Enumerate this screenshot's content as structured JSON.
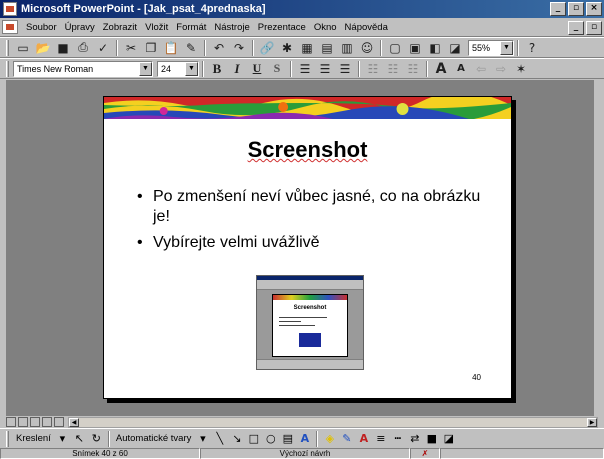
{
  "window": {
    "title": "Microsoft PowerPoint - [Jak_psat_4prednaska]",
    "minimize": "_",
    "restore": "▫",
    "close": "×",
    "doc_minimize": "_",
    "doc_restore": "▫"
  },
  "menu": {
    "items": [
      "Soubor",
      "Úpravy",
      "Zobrazit",
      "Vložit",
      "Formát",
      "Nástroje",
      "Prezentace",
      "Okno",
      "Nápověda"
    ]
  },
  "toolbar": {
    "zoom": "55%"
  },
  "formatting": {
    "font_name": "Times New Roman",
    "font_size": "24",
    "bold": "B",
    "italic": "I",
    "underline": "U",
    "shadow": "S"
  },
  "slide": {
    "title": "Screenshot",
    "bullets": [
      "Po zmenšení neví vůbec jasné, co na obrázku je!",
      "Vybírejte velmi uvážlivě"
    ],
    "number": "40",
    "thumbnail": {
      "title": "Screenshot"
    }
  },
  "drawing_toolbar": {
    "draw_label": "Kreslení",
    "autoshapes_label": "Automatické tvary"
  },
  "status": {
    "slide_info": "Snímek 40 z 60",
    "design": "Výchozí návrh"
  },
  "colors": {
    "titlebar": "#0a246a",
    "workspace": "#808080",
    "chrome": "#c0c0c0"
  }
}
